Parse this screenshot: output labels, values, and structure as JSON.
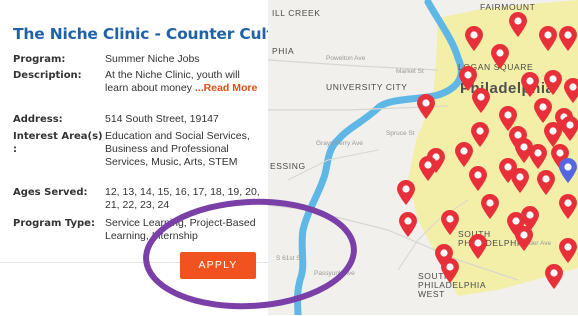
{
  "listing": {
    "title": "The Niche Clinic - Counter Culture",
    "fields": {
      "program": {
        "label": "Program:",
        "value": "Summer Niche Jobs"
      },
      "description": {
        "label": "Description:",
        "value": "At the Niche Clinic, youth will learn about money",
        "read_more": "...Read More"
      },
      "address": {
        "label": "Address:",
        "value": "514 South Street, 19147"
      },
      "interest": {
        "label": "Interest Area(s) :",
        "value": "Education and Social Services, Business and Professional Services, Music, Arts, STEM"
      },
      "ages": {
        "label": "Ages Served:",
        "value": "12, 13, 14, 15, 16, 17, 18, 19, 20, 21, 22, 23, 24"
      },
      "program_type": {
        "label": "Program Type:",
        "value": "Service Learning, Project-Based Learning, Internship"
      }
    },
    "apply_label": "APPLY"
  },
  "map": {
    "labels": {
      "hill_creek": "ILL CREEK",
      "fairmount": "FAIRMOUNT",
      "phia": "PHIA",
      "university_city": "UNIVERSITY CITY",
      "logan_square": "LOGAN SQUARE",
      "philadelphia": "Philadelphia",
      "essing": "ESSING",
      "south_philadelphia": "SOUTH PHILADELPHIA",
      "south_philadelphia_west": "SOUTH PHILADELPHIA WEST",
      "powelton_ave": "Powelton Ave",
      "market_st": "Market St",
      "spruce_st": "Spruce St",
      "grays_ferry_ave": "Grays Ferry Ave",
      "passyunk_ave": "Passyunk Ave",
      "snyder_ave": "Snyder Ave",
      "s_61st": "S 61st St"
    },
    "colors": {
      "land": "#f1f0ec",
      "water": "#5fb7e6",
      "highlight": "#f3efa8",
      "pin": "#e8303a",
      "selected_pin": "#5466e0",
      "annotation": "#7b3fa8"
    }
  }
}
